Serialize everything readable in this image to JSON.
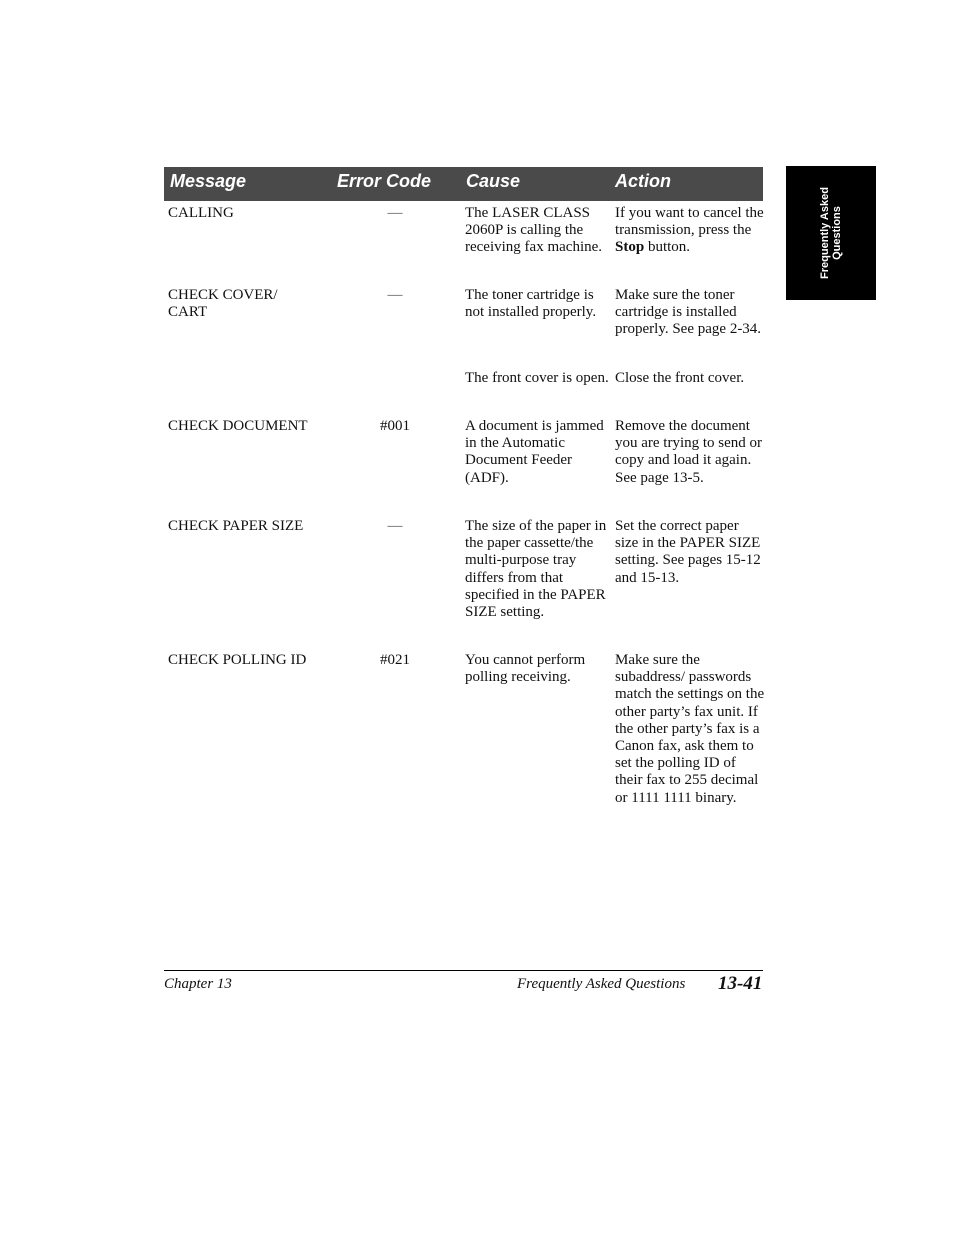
{
  "side_tab": {
    "line1": "Frequently Asked",
    "line2": "Questions"
  },
  "table": {
    "headers": {
      "message": "Message",
      "error_code": "Error Code",
      "cause": "Cause",
      "action": "Action"
    },
    "rows": [
      {
        "message": "CALLING",
        "error_code": "—",
        "cause": "The LASER CLASS 2060P is calling the receiving fax machine.",
        "action_pre": "If you want to cancel the transmission, press the ",
        "action_bold": "Stop",
        "action_post": " button."
      },
      {
        "message": "CHECK COVER/ CART",
        "error_code": "—",
        "cause": "The toner cartridge is not installed properly.",
        "action": "Make sure the toner cartridge is installed properly. See page 2-34."
      },
      {
        "message": "",
        "error_code": "",
        "cause": "The front cover is open.",
        "action": "Close the front cover."
      },
      {
        "message": "CHECK DOCUMENT",
        "error_code": "#001",
        "cause": "A document is jammed in the Automatic Document Feeder (ADF).",
        "action": "Remove the document you are trying to send or copy and load it again. See page 13-5."
      },
      {
        "message": "CHECK PAPER SIZE",
        "error_code": "—",
        "cause": "The size of the paper in the paper cassette/the multi-purpose tray differs from that specified in the PAPER SIZE setting.",
        "action": "Set the correct paper size in the PAPER SIZE setting. See pages 15-12 and 15-13."
      },
      {
        "message": "CHECK POLLING ID",
        "error_code": "#021",
        "cause": "You cannot perform polling receiving.",
        "action": "Make sure the subaddress/ passwords match the settings on the other party’s fax unit. If the other party’s fax is a Canon fax, ask them to set the polling ID of their fax to 255 decimal or 1111 1111 binary."
      }
    ]
  },
  "footer": {
    "chapter": "Chapter 13",
    "section": "Frequently Asked Questions",
    "page": "13-41"
  },
  "colors": {
    "header_bg": "#4a4a4a",
    "tab_bg": "#000000"
  }
}
